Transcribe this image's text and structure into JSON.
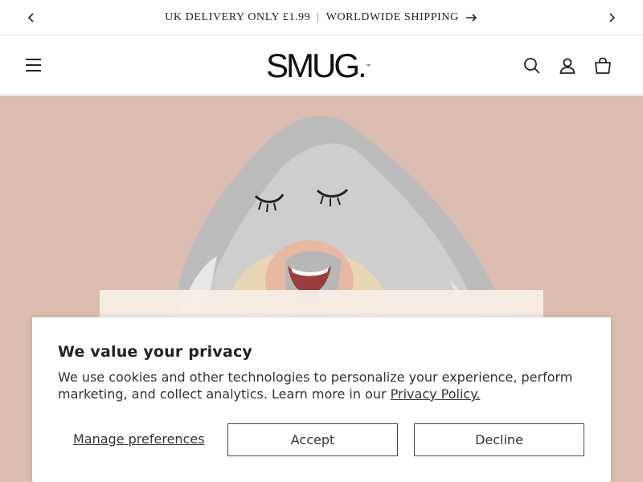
{
  "announcement": {
    "part1": "UK DELIVERY ONLY £1.99",
    "separator": "|",
    "part2": "WORLDWIDE SHIPPING"
  },
  "header": {
    "logo": "SMUG.",
    "logo_tm": "™"
  },
  "icons": {
    "prev": "chevron-left-icon",
    "next": "chevron-right-icon",
    "announce_arrow": "arrow-right-icon",
    "menu": "hamburger-icon",
    "search": "search-icon",
    "account": "user-icon",
    "cart": "bag-icon"
  },
  "cookie": {
    "title": "We value your privacy",
    "body": "We use cookies and other technologies to personalize your experience, perform marketing, and collect analytics. Learn more in our ",
    "policy_link": "Privacy Policy.",
    "manage_label": "Manage preferences",
    "accept_label": "Accept",
    "decline_label": "Decline"
  },
  "colors": {
    "hero_bg": "#dcbdb0",
    "text": "#121212",
    "border": "#e6e6e6"
  }
}
